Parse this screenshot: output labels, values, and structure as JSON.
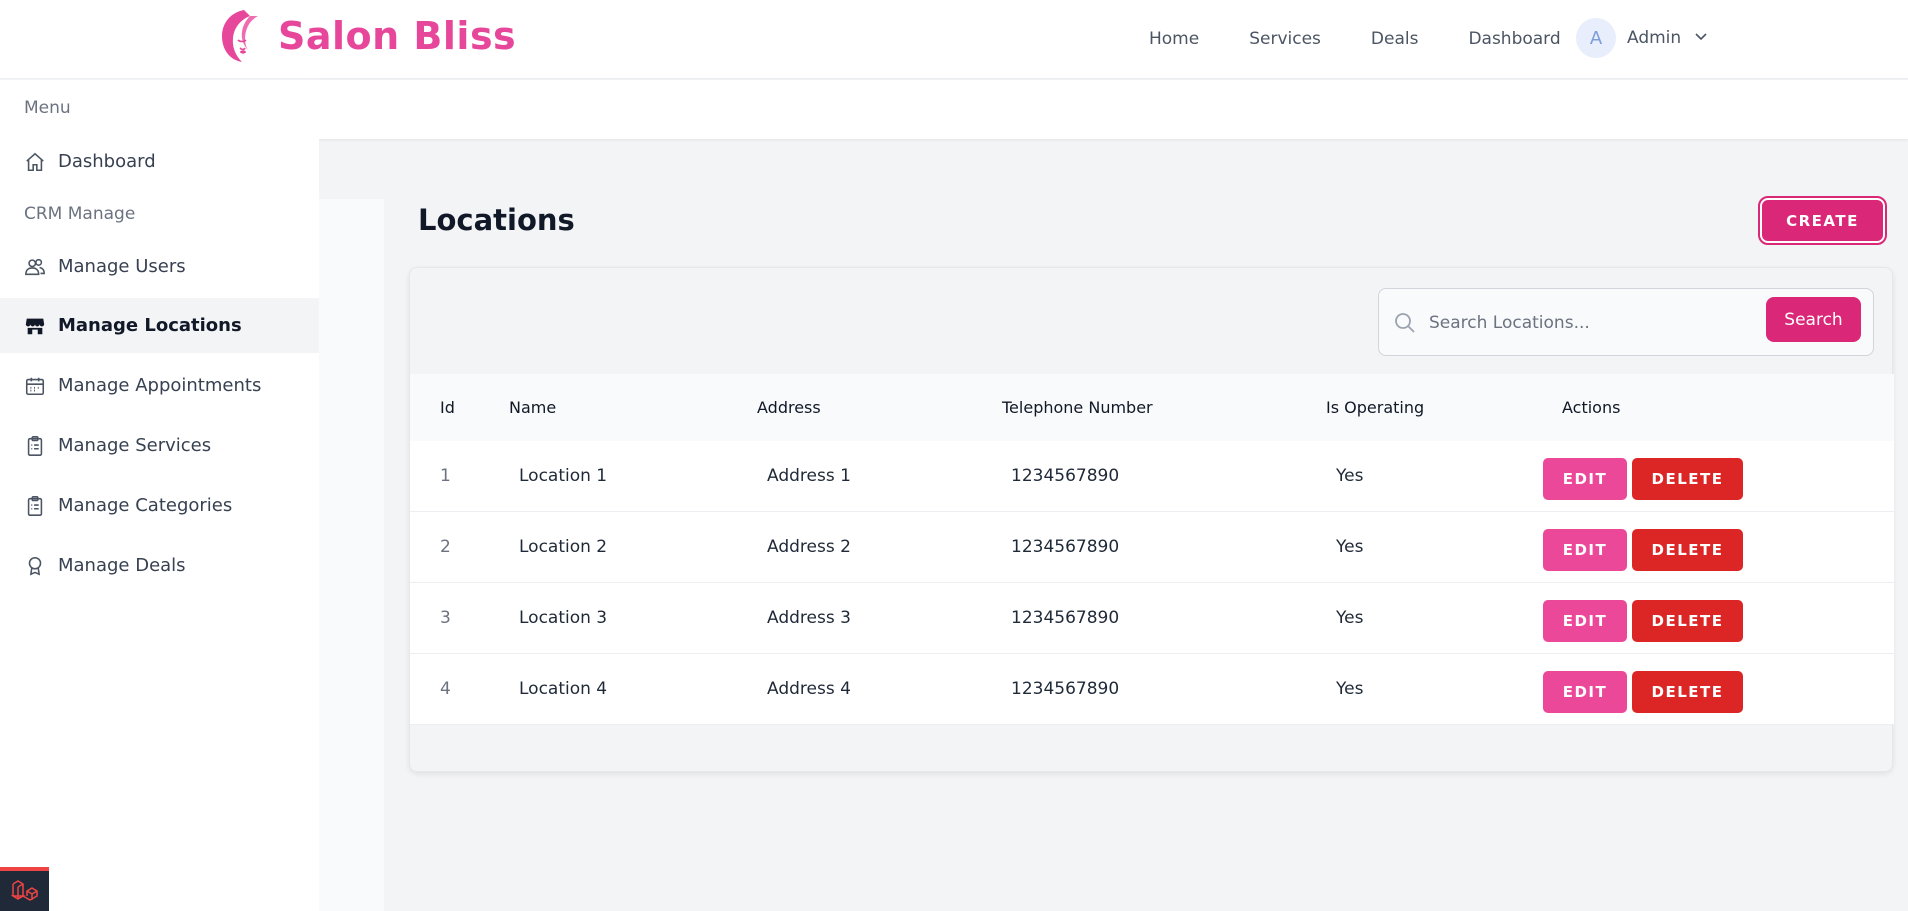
{
  "brand": {
    "name": "Salon Bliss",
    "color": "#e7479a"
  },
  "nav": {
    "links": [
      "Home",
      "Services",
      "Deals",
      "Dashboard"
    ],
    "user": {
      "initial": "A",
      "name": "Admin"
    }
  },
  "sidebar": {
    "menu_heading": "Menu",
    "crm_heading": "CRM Manage",
    "items": [
      {
        "label": "Dashboard",
        "icon": "home-icon"
      },
      {
        "label": "Manage Users",
        "icon": "users-icon"
      },
      {
        "label": "Manage Locations",
        "icon": "store-icon",
        "active": true
      },
      {
        "label": "Manage Appointments",
        "icon": "calendar-icon"
      },
      {
        "label": "Manage Services",
        "icon": "clipboard-icon"
      },
      {
        "label": "Manage Categories",
        "icon": "clipboard-icon"
      },
      {
        "label": "Manage Deals",
        "icon": "badge-icon"
      }
    ]
  },
  "page": {
    "title": "Locations",
    "create_label": "CREATE"
  },
  "search": {
    "placeholder": "Search Locations...",
    "value": "",
    "button_label": "Search"
  },
  "table": {
    "columns": [
      "Id",
      "Name",
      "Address",
      "Telephone Number",
      "Is Operating",
      "Actions"
    ],
    "rows": [
      {
        "id": "1",
        "name": "Location 1",
        "address": "Address 1",
        "phone": "1234567890",
        "operating": "Yes"
      },
      {
        "id": "2",
        "name": "Location 2",
        "address": "Address 2",
        "phone": "1234567890",
        "operating": "Yes"
      },
      {
        "id": "3",
        "name": "Location 3",
        "address": "Address 3",
        "phone": "1234567890",
        "operating": "Yes"
      },
      {
        "id": "4",
        "name": "Location 4",
        "address": "Address 4",
        "phone": "1234567890",
        "operating": "Yes"
      }
    ],
    "edit_label": "EDIT",
    "delete_label": "DELETE"
  },
  "colors": {
    "primary": "#db2777",
    "edit": "#ec4899",
    "delete": "#dc2626"
  }
}
